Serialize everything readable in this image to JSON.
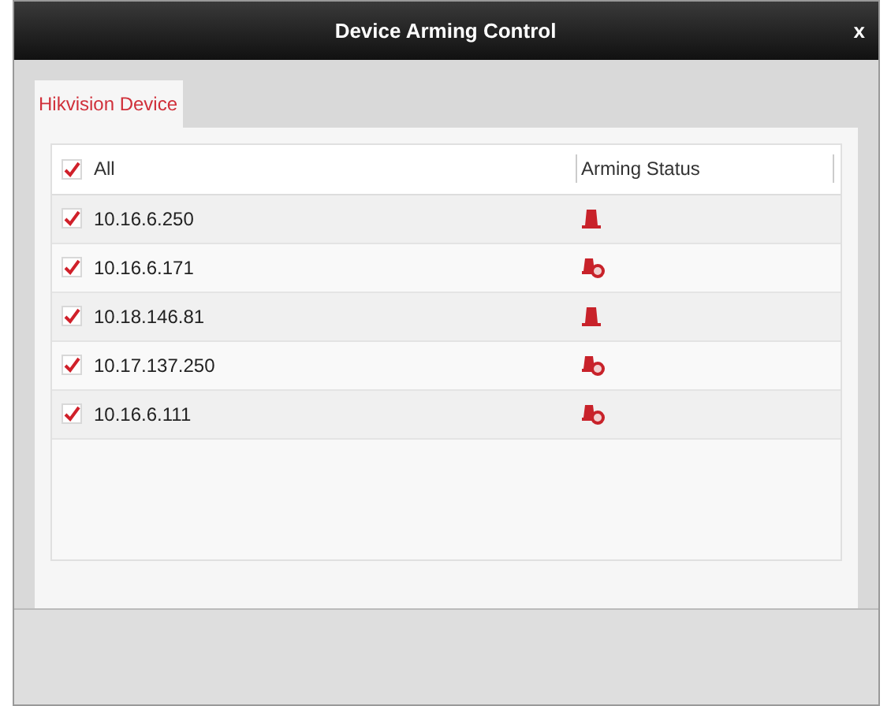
{
  "window": {
    "title": "Device Arming Control",
    "close": "x"
  },
  "tabs": [
    {
      "label": "Hikvision Device",
      "selected": true
    }
  ],
  "table": {
    "header": {
      "label": "All",
      "checked": true
    },
    "columns": [
      "Arming Status"
    ],
    "rows": [
      {
        "device": "10.16.6.250",
        "checked": true,
        "armed": true
      },
      {
        "device": "10.16.6.171",
        "checked": true,
        "armed": false
      },
      {
        "device": "10.18.146.81",
        "checked": true,
        "armed": true
      },
      {
        "device": "10.17.137.250",
        "checked": true,
        "armed": false
      },
      {
        "device": "10.16.6.111",
        "checked": true,
        "armed": false
      }
    ]
  }
}
